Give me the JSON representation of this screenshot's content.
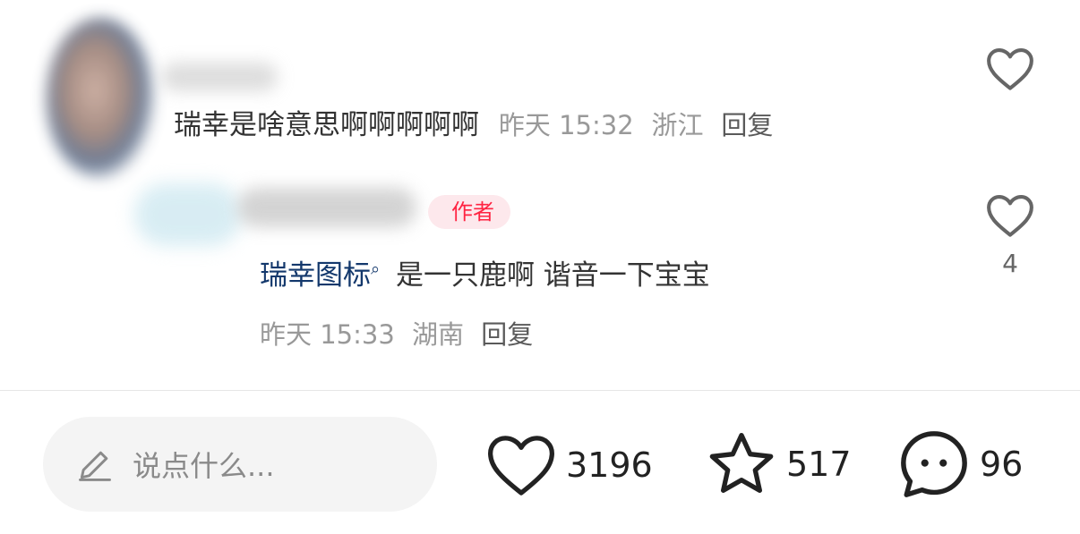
{
  "comment": {
    "text": "瑞幸是啥意思啊啊啊啊啊",
    "date": "昨天 15:32",
    "location": "浙江",
    "reply_label": "回复"
  },
  "reply": {
    "author_tag": "作者",
    "link_word": "瑞幸图标",
    "text": "是一只鹿啊 谐音一下宝宝",
    "date": "昨天 15:33",
    "location": "湖南",
    "reply_label": "回复",
    "like_count": "4"
  },
  "bottom_bar": {
    "input_placeholder": "说点什么...",
    "like_count": "3196",
    "collect_count": "517",
    "comment_count": "96"
  },
  "icons": {
    "like": "heart-outline-icon",
    "collect": "star-outline-icon",
    "comment": "chat-bubble-icon",
    "edit": "pencil-icon",
    "search": "search-icon"
  },
  "colors": {
    "author_tag_text": "#ff2442",
    "author_tag_bg": "#fde8ec",
    "link_word": "#13386c",
    "meta_text": "#999999"
  }
}
